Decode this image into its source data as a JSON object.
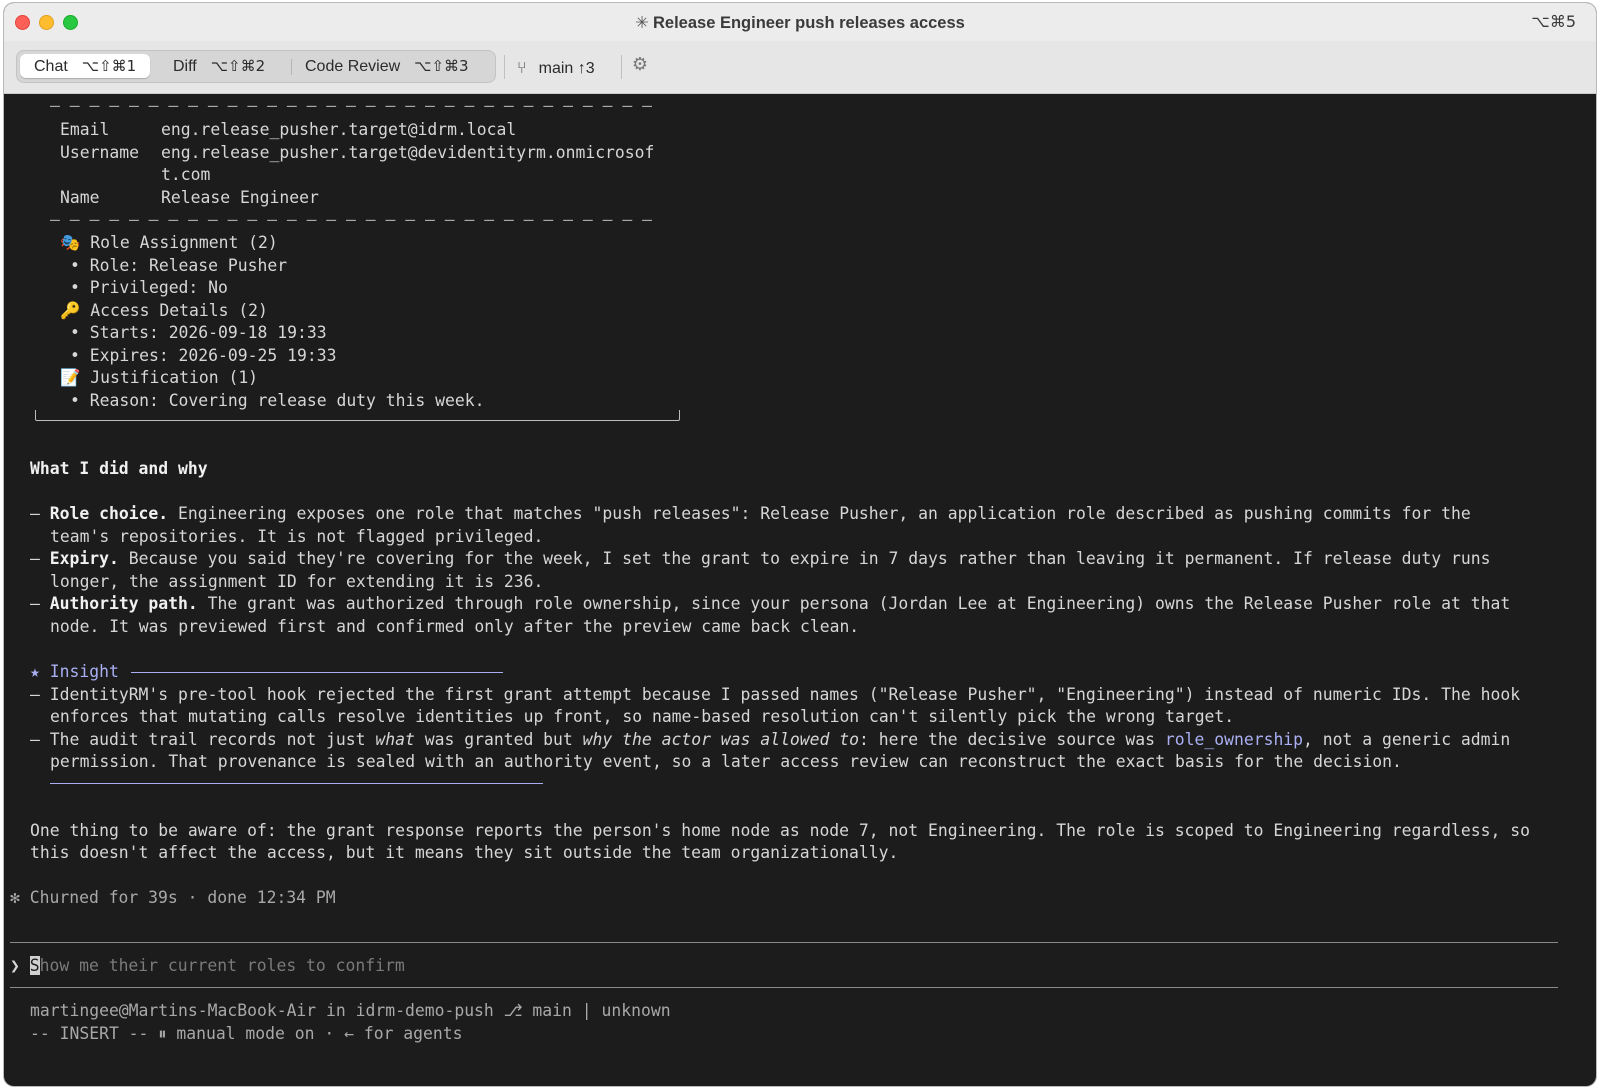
{
  "window": {
    "title": "Release Engineer push releases access",
    "title_icon": "asterisk-spinner-icon",
    "shortcut": "⌥⌘5"
  },
  "toolbar": {
    "tabs": [
      {
        "label": "Chat",
        "shortcut": "⌥⇧⌘1",
        "active": true
      },
      {
        "label": "Diff",
        "shortcut": "⌥⇧⌘2",
        "active": false
      },
      {
        "label": "Code Review",
        "shortcut": "⌥⇧⌘3",
        "active": false
      }
    ],
    "branch": {
      "name": "main",
      "ahead": "↑3"
    }
  },
  "card": {
    "divider": "– – – – – – – – – – – – – – – – – – – – – – – – – – – – – – –",
    "fields": [
      {
        "label": "Email",
        "value": "eng.release_pusher.target@idrm.local"
      },
      {
        "label": "Username",
        "value": "eng.release_pusher.target@devidentityrm.onmicrosof",
        "value_cont": "t.com"
      },
      {
        "label": "Name",
        "value": "Release Engineer"
      }
    ],
    "sections": [
      {
        "icon": "🎭",
        "title": "Role Assignment (2)",
        "items": [
          "Role: Release Pusher",
          "Privileged: No"
        ]
      },
      {
        "icon": "🔑",
        "title": "Access Details (2)",
        "items": [
          "Starts: 2026-09-18 19:33",
          "Expires: 2026-09-25 19:33"
        ]
      },
      {
        "icon": "📝",
        "title": "Justification (1)",
        "items": [
          "Reason: Covering release duty this week."
        ]
      }
    ]
  },
  "explanation": {
    "heading": "What I did and why",
    "bullets": [
      {
        "term": "Role choice.",
        "l1": " Engineering exposes one role that matches \"push releases\": Release Pusher, an application role described as pushing commits for the",
        "l2": "team's repositories. It is not flagged privileged."
      },
      {
        "term": "Expiry.",
        "l1": " Because you said they're covering for the week, I set the grant to expire in 7 days rather than leaving it permanent. If release duty runs",
        "l2": "longer, the assignment ID for extending it is 236."
      },
      {
        "term": "Authority path.",
        "l1": " The grant was authorized through role ownership, since your persona (Jordan Lee at Engineering) owns the Release Pusher role at that",
        "l2": "node. It was previewed first and confirmed only after the preview came back clean."
      }
    ]
  },
  "insight": {
    "label": "★ Insight",
    "b1_l1": "IdentityRM's pre-tool hook rejected the first grant attempt because I passed names (\"Release Pusher\", \"Engineering\") instead of numeric IDs. The hook",
    "b1_l2": "enforces that mutating calls resolve identities up front, so name-based resolution can't silently pick the wrong target.",
    "b2_pre": "The audit trail records not just ",
    "b2_it1": "what",
    "b2_mid": " was granted but ",
    "b2_it2": "why the actor was allowed to",
    "b2_mid2": ": here the decisive source was ",
    "b2_code": "role_ownership",
    "b2_post": ", not a generic admin",
    "b2_l2": "permission. That provenance is sealed with an authority event, so a later access review can reconstruct the exact basis for the decision."
  },
  "note": {
    "l1": "One thing to be aware of: the grant response reports the person's home node as node 7, not Engineering. The role is scoped to Engineering regardless, so",
    "l2": "this doesn't affect the access, but it means they sit outside the team organizationally."
  },
  "status": {
    "icon": "✻",
    "text": "Churned for 39s · done 12:34 PM"
  },
  "prompt": {
    "symbol": "❯",
    "caret_char": "S",
    "placeholder": "how me their current roles to confirm"
  },
  "footer": {
    "l1": "martingee@Martins-MacBook-Air in idrm-demo-push ⎇ main | unknown",
    "l2": "-- INSERT -- ⏸ manual mode on · ← for agents"
  },
  "colors": {
    "accent": "#a9aff2",
    "background": "#1c1c1c",
    "text": "#d6d6d6"
  }
}
